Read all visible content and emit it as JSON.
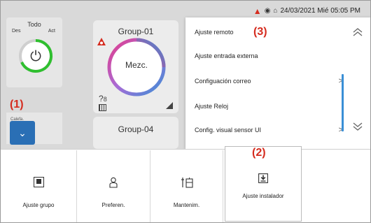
{
  "status_bar": {
    "datetime": "24/03/2021 Mié 05:05 PM",
    "icons": [
      "alarm-icon",
      "shield-icon",
      "maintenance-icon"
    ]
  },
  "all_units": {
    "title": "Todo",
    "label_left": "Des",
    "label_right": "Act",
    "icon": "power-icon"
  },
  "side_menu": {
    "label": "Calefa.\nProgram."
  },
  "callouts": [
    "(1)",
    "(2)",
    "(3)"
  ],
  "groups": [
    {
      "name": "Group-01",
      "mode": "Mezc."
    },
    {
      "name": "Group-04"
    }
  ],
  "settings_menu": {
    "items": [
      {
        "label": "Ajuste remoto"
      },
      {
        "label": "Ajuste entrada externa"
      },
      {
        "label": "Configuación correo"
      },
      {
        "label": "Ajuste Reloj"
      },
      {
        "label": "Config. visual sensor UI"
      }
    ],
    "chevron": ">"
  },
  "bottom_bar": {
    "items": [
      {
        "label": "Ajuste grupo",
        "icon": "group-settings-icon"
      },
      {
        "label": "Preferen.",
        "icon": "user-icon"
      },
      {
        "label": "Mantenim.",
        "icon": "maintenance-icon"
      },
      {
        "label": "Ajuste instalador",
        "icon": "installer-icon"
      }
    ]
  },
  "colors": {
    "accent_blue": "#2a6fb5",
    "callout_red": "#d52b1e",
    "on_green": "#2fbf2f"
  }
}
